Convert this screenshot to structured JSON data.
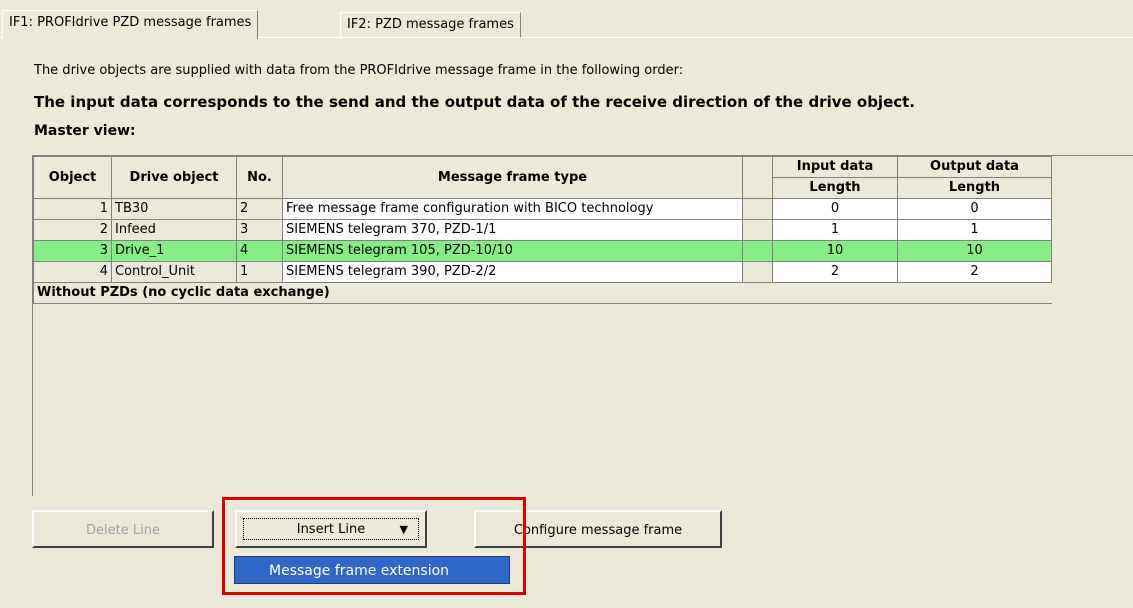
{
  "tabs": [
    {
      "label": "IF1:  PROFIdrive  PZD message frames"
    },
    {
      "label": "IF2:  PZD message frames"
    }
  ],
  "intro": {
    "line1": "The drive objects are supplied with data from the PROFIdrive message frame in the following order:",
    "line2": "The input data corresponds to the send and the output data of the receive direction of the drive object.",
    "line3": "Master view:"
  },
  "table": {
    "headers": {
      "object": "Object",
      "drive_object": "Drive object",
      "no": "No.",
      "message_frame_type": "Message frame type",
      "input_data": "Input data",
      "output_data": "Output data",
      "length": "Length"
    },
    "rows": [
      {
        "object": "1",
        "drive_object": "TB30",
        "no": "2",
        "type": "Free message frame configuration with BICO technology",
        "input": "0",
        "output": "0"
      },
      {
        "object": "2",
        "drive_object": "Infeed",
        "no": "3",
        "type": "SIEMENS telegram 370, PZD-1/1",
        "input": "1",
        "output": "1"
      },
      {
        "object": "3",
        "drive_object": "Drive_1",
        "no": "4",
        "type": "SIEMENS telegram 105, PZD-10/10",
        "input": "10",
        "output": "10"
      },
      {
        "object": "4",
        "drive_object": "Control_Unit",
        "no": "1",
        "type": "SIEMENS telegram 390, PZD-2/2",
        "input": "2",
        "output": "2"
      }
    ],
    "footer": "Without PZDs (no cyclic data exchange)",
    "selected_row_color": "#85ef85"
  },
  "buttons": {
    "delete": "Delete Line",
    "insert": "Insert Line",
    "configure": "Configure message frame"
  },
  "dropdown": {
    "item": "Message frame extension"
  },
  "colors": {
    "dialog_bg": "#ece9d8",
    "selection": "#3166c9",
    "highlight_box": "#e00000"
  }
}
